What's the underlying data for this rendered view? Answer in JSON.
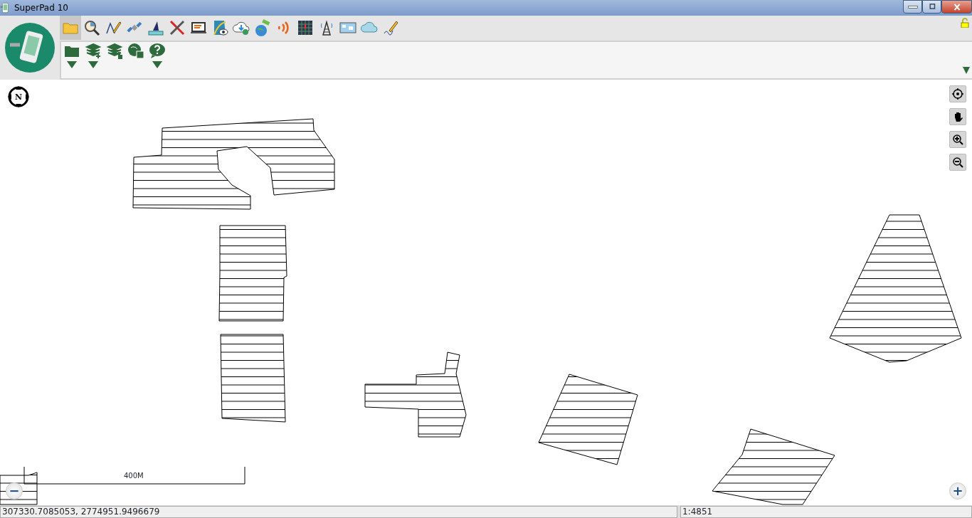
{
  "window": {
    "title": "SuperPad 10"
  },
  "toolbar": {
    "main_tools": [
      {
        "selected": true
      },
      {
        "selected": false
      },
      {
        "selected": false
      },
      {
        "selected": false
      },
      {
        "selected": false
      },
      {
        "selected": false
      },
      {
        "selected": false
      },
      {
        "selected": false
      },
      {
        "selected": false
      },
      {
        "selected": false
      },
      {
        "selected": false
      },
      {
        "selected": false
      },
      {
        "selected": false
      },
      {
        "selected": false
      },
      {
        "selected": false
      },
      {
        "selected": false
      }
    ],
    "sub_tools": [
      {
        "has_menu": true
      },
      {
        "has_menu": true
      },
      {
        "has_menu": false
      },
      {
        "has_menu": false
      },
      {
        "has_menu": true
      }
    ]
  },
  "map": {
    "north_arrow": "N",
    "scale_bar": "400M",
    "zoom_out": "−",
    "zoom_in": "+"
  },
  "status_bar": {
    "coordinates": "307330.7085053, 2774951.9496679",
    "scale": "1:4851"
  }
}
